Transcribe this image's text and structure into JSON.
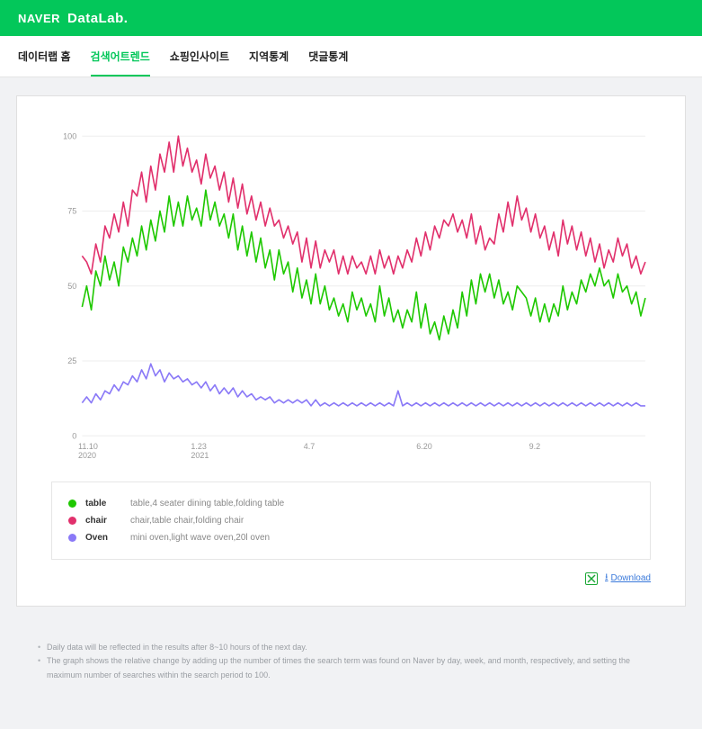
{
  "header": {
    "brand": "NAVER",
    "product": "DataLab."
  },
  "nav": {
    "items": [
      {
        "label": "데이터랩 홈"
      },
      {
        "label": "검색어트렌드"
      },
      {
        "label": "쇼핑인사이트"
      },
      {
        "label": "지역통계"
      },
      {
        "label": "댓글통계"
      }
    ],
    "activeIndex": 1
  },
  "legend": [
    {
      "color": "#1ec800",
      "name": "table",
      "terms": "table,4 seater dining table,folding table"
    },
    {
      "color": "#e1306c",
      "name": "chair",
      "terms": "chair,table chair,folding chair"
    },
    {
      "color": "#8a79f7",
      "name": "Oven",
      "terms": "mini oven,light wave oven,20l oven"
    }
  ],
  "download": {
    "icon_label": "xls",
    "link_text": "Download"
  },
  "notes": [
    "Daily data will be reflected in the results after 8~10 hours of the next day.",
    "The graph shows the relative change by adding up the number of times the search term was found on Naver by day, week, and month, respectively, and setting the maximum number of searches within the search period to 100."
  ],
  "chart_data": {
    "type": "line",
    "title": "",
    "xlabel": "",
    "ylabel": "",
    "ylim": [
      0,
      100
    ],
    "yticks": [
      0,
      25,
      50,
      75,
      100
    ],
    "x_tick_labels": [
      {
        "pos": 0.0,
        "label": "11.10",
        "sublabel": "2020"
      },
      {
        "pos": 0.2,
        "label": "1.23",
        "sublabel": "2021"
      },
      {
        "pos": 0.4,
        "label": "4.7",
        "sublabel": ""
      },
      {
        "pos": 0.6,
        "label": "6.20",
        "sublabel": ""
      },
      {
        "pos": 0.8,
        "label": "9.2",
        "sublabel": ""
      }
    ],
    "series": [
      {
        "name": "table",
        "color": "#1ec800",
        "values": [
          43,
          50,
          42,
          55,
          50,
          60,
          52,
          58,
          50,
          63,
          58,
          66,
          60,
          70,
          62,
          72,
          65,
          75,
          68,
          80,
          70,
          78,
          70,
          80,
          72,
          76,
          70,
          82,
          72,
          78,
          70,
          74,
          66,
          74,
          62,
          70,
          60,
          68,
          58,
          66,
          56,
          62,
          52,
          62,
          54,
          58,
          48,
          56,
          46,
          52,
          44,
          54,
          44,
          50,
          42,
          46,
          40,
          44,
          38,
          48,
          42,
          46,
          40,
          44,
          38,
          50,
          40,
          46,
          38,
          42,
          36,
          42,
          38,
          48,
          36,
          44,
          34,
          38,
          32,
          40,
          34,
          42,
          36,
          48,
          40,
          52,
          44,
          54,
          48,
          54,
          46,
          52,
          44,
          48,
          42,
          50,
          48,
          46,
          40,
          46,
          38,
          44,
          38,
          44,
          40,
          50,
          42,
          48,
          44,
          52,
          48,
          54,
          50,
          56,
          50,
          52,
          46,
          54,
          48,
          50,
          44,
          48,
          40,
          46
        ]
      },
      {
        "name": "chair",
        "color": "#e1306c",
        "values": [
          60,
          58,
          54,
          64,
          58,
          70,
          66,
          74,
          68,
          78,
          70,
          82,
          80,
          88,
          78,
          90,
          82,
          94,
          88,
          98,
          88,
          100,
          90,
          96,
          88,
          92,
          84,
          94,
          86,
          90,
          82,
          88,
          78,
          86,
          76,
          84,
          74,
          80,
          72,
          78,
          70,
          76,
          70,
          72,
          66,
          70,
          64,
          68,
          58,
          66,
          56,
          65,
          56,
          62,
          58,
          62,
          54,
          60,
          54,
          60,
          56,
          58,
          54,
          60,
          54,
          62,
          56,
          60,
          54,
          60,
          56,
          62,
          58,
          66,
          60,
          68,
          62,
          70,
          66,
          72,
          70,
          74,
          68,
          72,
          66,
          74,
          64,
          70,
          62,
          66,
          64,
          74,
          68,
          78,
          70,
          80,
          72,
          76,
          68,
          74,
          66,
          70,
          62,
          68,
          60,
          72,
          64,
          70,
          62,
          68,
          60,
          66,
          58,
          64,
          56,
          62,
          58,
          66,
          60,
          64,
          56,
          60,
          54,
          58
        ]
      },
      {
        "name": "Oven",
        "color": "#8a79f7",
        "values": [
          11,
          13,
          11,
          14,
          12,
          15,
          14,
          17,
          15,
          18,
          17,
          20,
          18,
          22,
          19,
          24,
          20,
          22,
          18,
          21,
          19,
          20,
          18,
          19,
          17,
          18,
          16,
          18,
          15,
          17,
          14,
          16,
          14,
          16,
          13,
          15,
          13,
          14,
          12,
          13,
          12,
          13,
          11,
          12,
          11,
          12,
          11,
          12,
          11,
          12,
          10,
          12,
          10,
          11,
          10,
          11,
          10,
          11,
          10,
          11,
          10,
          11,
          10,
          11,
          10,
          11,
          10,
          11,
          10,
          15,
          10,
          11,
          10,
          11,
          10,
          11,
          10,
          11,
          10,
          11,
          10,
          11,
          10,
          11,
          10,
          11,
          10,
          11,
          10,
          11,
          10,
          11,
          10,
          11,
          10,
          11,
          10,
          11,
          10,
          11,
          10,
          11,
          10,
          11,
          10,
          11,
          10,
          11,
          10,
          11,
          10,
          11,
          10,
          11,
          10,
          11,
          10,
          11,
          10,
          11,
          10,
          11,
          10,
          10
        ]
      }
    ]
  }
}
